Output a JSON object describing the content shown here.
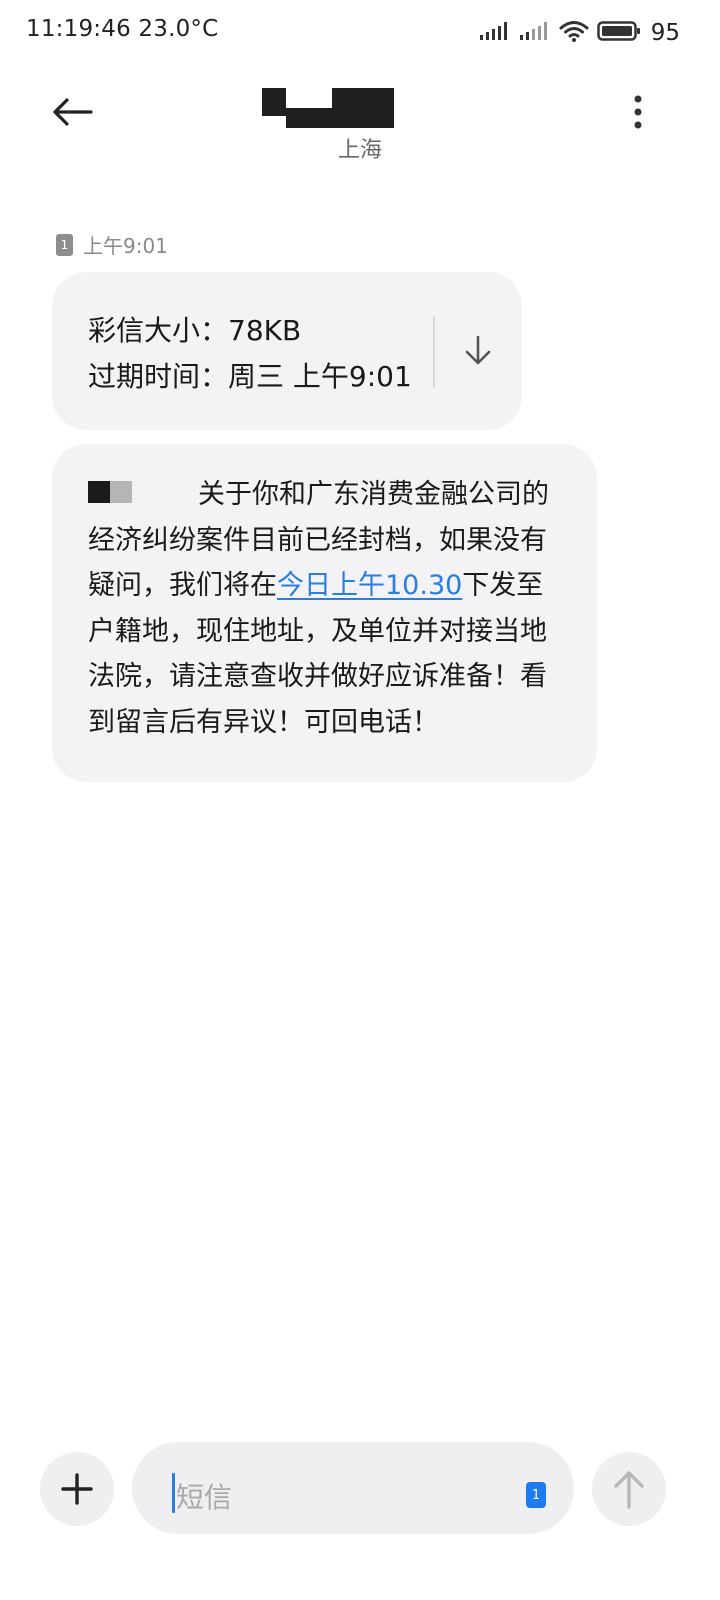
{
  "status_bar": {
    "time_temp": "11:19:46 23.0°C",
    "battery_level": "95"
  },
  "header": {
    "contact_location": "上海"
  },
  "conversation": {
    "timestamp": "上午9:01",
    "sim_label": "1",
    "mms": {
      "size_line": "彩信大小：78KB",
      "expiry_line": "过期时间：周三 上午9:01"
    },
    "message": {
      "line1": "关于你和广东消费金融公司的",
      "line2": "经济纠纷案件目前已经封档，如果没有",
      "line3_pre": "疑问，我们将在",
      "line3_link": "今日上午10.30",
      "line3_post": "下发至",
      "line4": "户籍地，现住地址，及单位并对接当地",
      "line5": "法院，请注意查收并做好应诉准备！看",
      "line6": "到留言后有异议！可回电话！"
    }
  },
  "composer": {
    "placeholder": "短信",
    "sim_label": "1"
  },
  "colors": {
    "accent": "#2a7de1",
    "bubble": "#f3f3f5",
    "sim_blue": "#1e7bf2"
  },
  "icons": [
    "back-arrow-icon",
    "more-vert-icon",
    "download-arrow-icon",
    "plus-icon",
    "send-arrow-icon",
    "signal-icon",
    "wifi-icon",
    "battery-icon",
    "sim-card-icon"
  ]
}
